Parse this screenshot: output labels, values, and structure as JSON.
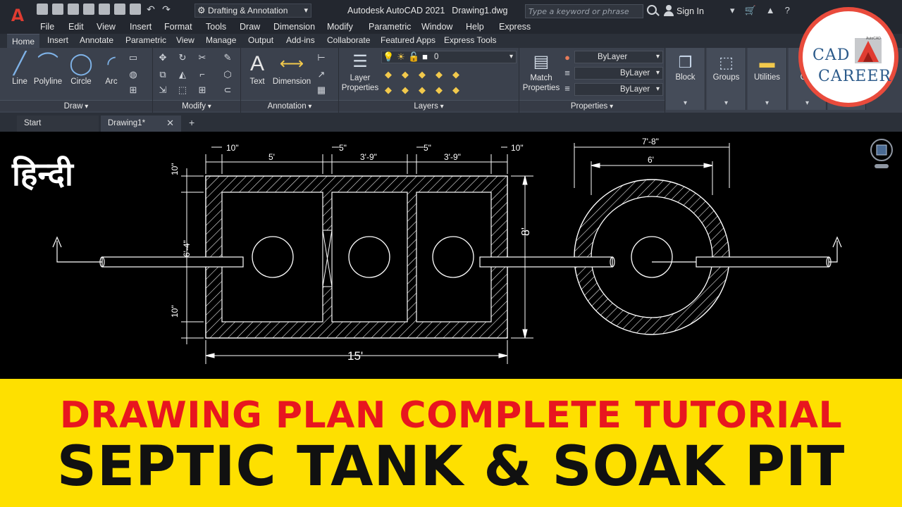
{
  "app": {
    "logo": "A",
    "workspace": "Drafting & Annotation",
    "title": "Autodesk AutoCAD 2021",
    "document": "Drawing1.dwg",
    "search_placeholder": "Type a keyword or phrase",
    "sign_in": "Sign In"
  },
  "menu": [
    "File",
    "Edit",
    "View",
    "Insert",
    "Format",
    "Tools",
    "Draw",
    "Dimension",
    "Modify",
    "Parametric",
    "Window",
    "Help",
    "Express"
  ],
  "ribbon_tabs": [
    "Home",
    "Insert",
    "Annotate",
    "Parametric",
    "View",
    "Manage",
    "Output",
    "Add-ins",
    "Collaborate",
    "Featured Apps",
    "Express Tools"
  ],
  "panels": {
    "draw": {
      "label": "Draw",
      "tools": [
        "Line",
        "Polyline",
        "Circle",
        "Arc"
      ]
    },
    "modify": {
      "label": "Modify"
    },
    "annotation": {
      "label": "Annotation",
      "tools": [
        "Text",
        "Dimension"
      ]
    },
    "layers": {
      "label": "Layers",
      "tool_line1": "Layer",
      "tool_line2": "Properties",
      "current_layer": "0"
    },
    "properties": {
      "label": "Properties",
      "tool_line1": "Match",
      "tool_line2": "Properties",
      "color": "ByLayer",
      "linetype": "ByLayer",
      "lineweight": "ByLayer"
    },
    "block": "Block",
    "groups": "Groups",
    "utilities": "Utilities",
    "clipboard": "Clip"
  },
  "file_tabs": {
    "start": "Start",
    "drawing": "Drawing1*"
  },
  "drawing": {
    "hindi": "हिन्दी",
    "dims": {
      "wall_left": "10\"",
      "chamber1": "5'",
      "wall_mid1": "5\"",
      "chamber2": "3'-9\"",
      "wall_mid2": "5\"",
      "chamber3": "3'-9\"",
      "wall_right": "10\"",
      "total_length": "15'",
      "height_outer": "8'",
      "height_inner": "6'-4\"",
      "wall_top": "10\"",
      "wall_bottom": "10\"",
      "pit_outer": "7'-8\"",
      "pit_inner": "6'"
    }
  },
  "logo": {
    "line1": "CAD",
    "line2": "CAREER",
    "mark_text": "AutoCAD"
  },
  "banner": {
    "line1": "DRAWING PLAN COMPLETE TUTORIAL",
    "line2": "SEPTIC TANK & SOAK PIT"
  },
  "colors": {
    "accent_red": "#e8161f",
    "banner_yellow": "#fee000",
    "autocad_red": "#e03c31"
  }
}
